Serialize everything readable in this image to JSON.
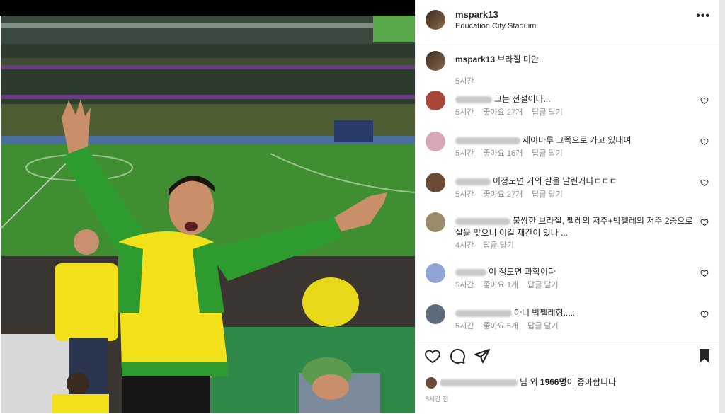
{
  "post": {
    "username": "mspark13",
    "location": "Education City Staduim"
  },
  "caption": {
    "username": "mspark13",
    "text": "브라질 미안..",
    "time": "5시간"
  },
  "comments": [
    {
      "text": "그는 전설이다...",
      "time": "5시간",
      "likes": "좋아요 27개",
      "reply": "답글 달기",
      "avatar_color": "#a8483b"
    },
    {
      "text": "세이마루 그쪽으로 가고 있대여",
      "time": "5시간",
      "likes": "좋아요 16개",
      "reply": "답글 달기",
      "avatar_color": "#d9a7b8"
    },
    {
      "text": "이정도면 거의 살을 날린거다ㄷㄷㄷ",
      "time": "5시간",
      "likes": "좋아요 27개",
      "reply": "답글 달기",
      "avatar_color": "#6a4b35"
    },
    {
      "text": "불쌍한 브라질, 펠레의 저주+박펠레의 저주 2중으로 살을 맞으니 이길 재간이 있나 ...",
      "time": "4시간",
      "likes": "",
      "reply": "답글 달기",
      "avatar_color": "#9a8a6a"
    },
    {
      "text": "이 정도면 과학이다",
      "time": "5시간",
      "likes": "좋아요 1개",
      "reply": "답글 달기",
      "avatar_color": "#8fa3d4"
    },
    {
      "text": "아니 박펠레형.....",
      "time": "5시간",
      "likes": "좋아요 5개",
      "reply": "답글 달기",
      "avatar_color": "#5e6b7a"
    }
  ],
  "likes": {
    "suffix": "님",
    "and": "외",
    "count": "1966명",
    "tail": "이 좋아합니다"
  },
  "timestamp": "5시간 전",
  "colors": {
    "jersey_green": "#2e9b2e",
    "jersey_yellow": "#f2e01a",
    "pitch": "#3f8f32",
    "crowd": "#2b3a2b"
  },
  "icons": [
    "heart-icon",
    "comment-icon",
    "share-icon",
    "bookmark-icon",
    "more-icon"
  ]
}
